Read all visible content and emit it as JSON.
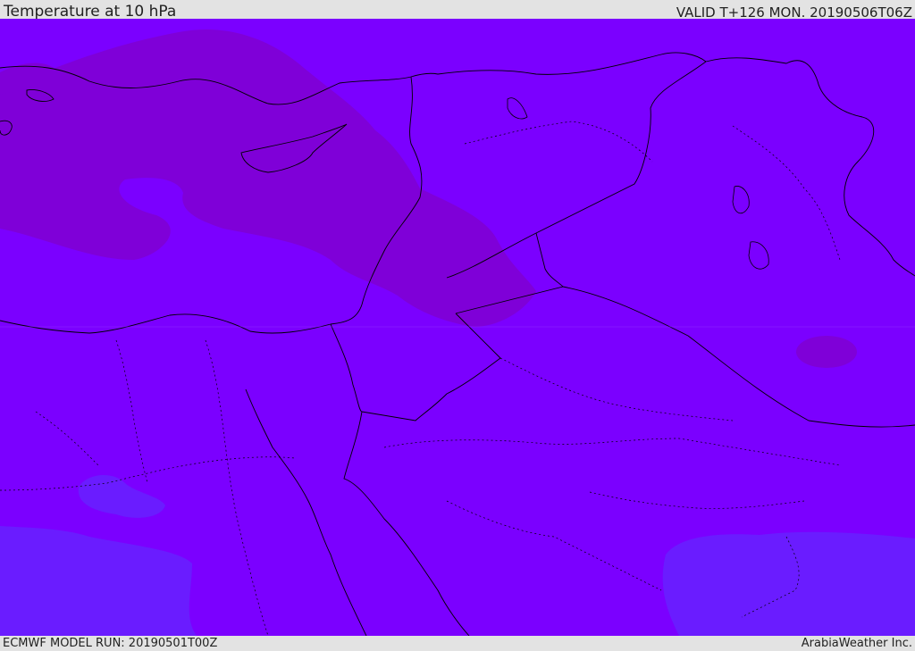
{
  "header": {
    "title": "Temperature at 10 hPa",
    "valid_time": "VALID T+126 MON. 20190506T06Z"
  },
  "footer": {
    "model_run": "ECMWF MODEL RUN: 20190501T00Z",
    "credit": "ArabiaWeather Inc."
  },
  "colors": {
    "base_field": "#7b00ff",
    "warm_band": "#7f00d8",
    "cool_patch": "#6a1cff",
    "coastline": "#000000"
  }
}
